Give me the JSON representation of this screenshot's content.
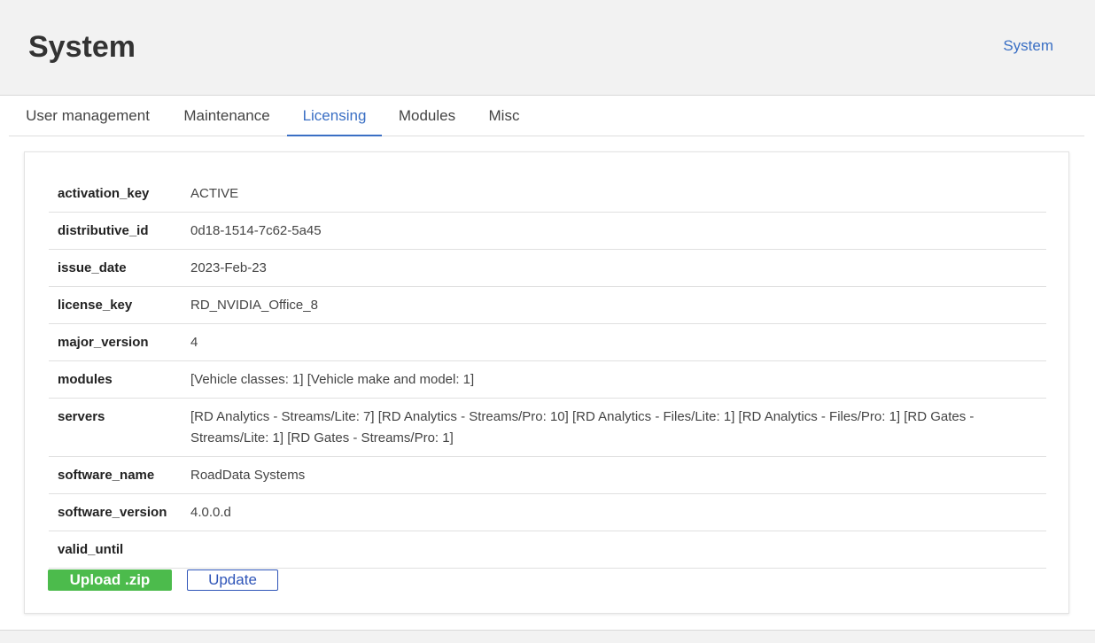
{
  "header": {
    "title": "System",
    "breadcrumb": "System"
  },
  "tabs": [
    {
      "label": "User management",
      "active": false
    },
    {
      "label": "Maintenance",
      "active": false
    },
    {
      "label": "Licensing",
      "active": true
    },
    {
      "label": "Modules",
      "active": false
    },
    {
      "label": "Misc",
      "active": false
    }
  ],
  "license": {
    "rows": [
      {
        "key": "activation_key",
        "value": "ACTIVE"
      },
      {
        "key": "distributive_id",
        "value": "0d18-1514-7c62-5a45"
      },
      {
        "key": "issue_date",
        "value": "2023-Feb-23"
      },
      {
        "key": "license_key",
        "value": "RD_NVIDIA_Office_8"
      },
      {
        "key": "major_version",
        "value": "4"
      },
      {
        "key": "modules",
        "value": "[Vehicle classes: 1] [Vehicle make and model: 1]"
      },
      {
        "key": "servers",
        "value": "[RD Analytics - Streams/Lite: 7] [RD Analytics - Streams/Pro: 10] [RD Analytics - Files/Lite: 1] [RD Analytics - Files/Pro: 1] [RD Gates - Streams/Lite: 1] [RD Gates - Streams/Pro: 1]"
      },
      {
        "key": "software_name",
        "value": "RoadData Systems"
      },
      {
        "key": "software_version",
        "value": "4.0.0.d"
      },
      {
        "key": "valid_until",
        "value": ""
      }
    ]
  },
  "actions": {
    "upload_label": "Upload .zip",
    "update_label": "Update"
  },
  "colors": {
    "accent": "#3a6fc4",
    "upload_button": "#4cbb4c",
    "update_button_border": "#2f55b8",
    "header_bg": "#f2f2f2"
  }
}
